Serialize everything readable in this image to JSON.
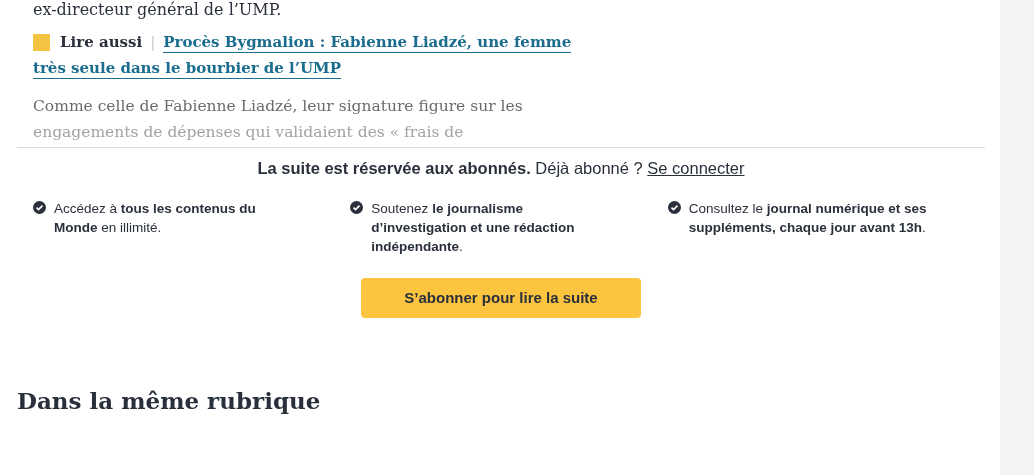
{
  "article": {
    "intro_end": "ex-directeur général de l’UMP.",
    "read_also": {
      "label": "Lire aussi",
      "separator": "|",
      "link_lines": [
        "Procès Bygmalion : Fabienne Liadzé, une femme",
        "très seule dans le bourbier de l’UMP"
      ]
    },
    "faded_lines": [
      "Comme celle de Fabienne Liadzé, leur signature figure sur les",
      "engagements de dépenses qui validaient des « frais de"
    ]
  },
  "paywall": {
    "title": "La suite est réservée aux abonnés.",
    "prompt": "Déjà abonné ?",
    "login_link": "Se connecter",
    "benefits": [
      {
        "text": "Accédez à **tous les contenus du Monde** en illimité."
      },
      {
        "text": "Soutenez **le journalisme d’investigation et une rédaction indépendante**."
      },
      {
        "text": "Consultez le **journal numérique et ses suppléments, chaque jour avant 13h**."
      }
    ],
    "button": "S’abonner pour lire la suite"
  },
  "section_heading": "Dans la même rubrique"
}
